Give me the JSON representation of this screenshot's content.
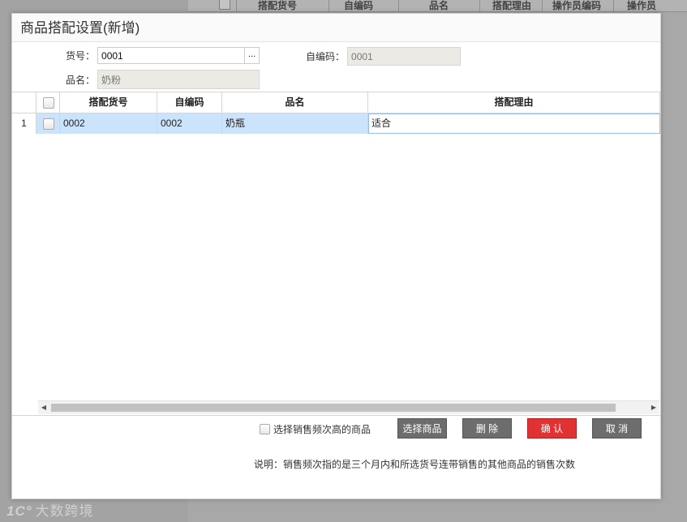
{
  "background": {
    "columns": [
      "搭配货号",
      "自编码",
      "品名",
      "搭配理由",
      "操作员编码",
      "操作员"
    ],
    "watermark": "大数跨境"
  },
  "dialog": {
    "title": "商品搭配设置(新增)",
    "form": {
      "code_label": "货号：",
      "code_value": "0001",
      "picker_label": "...",
      "self_code_label": "自编码：",
      "self_code_value": "0001",
      "name_label": "品名：",
      "name_value": "奶粉"
    },
    "grid": {
      "headers": [
        "搭配货号",
        "自编码",
        "品名",
        "搭配理由"
      ],
      "rows": [
        {
          "num": "1",
          "code": "0002",
          "self_code": "0002",
          "name": "奶瓶",
          "reason": "适合"
        }
      ]
    },
    "footer": {
      "checkbox_label": "选择销售频次高的商品",
      "select_button": "选择商品",
      "delete_button": "删 除",
      "confirm_button": "确 认",
      "cancel_button": "取 消",
      "note": "说明：销售频次指的是三个月内和所选货号连带销售的其他商品的销售次数"
    }
  }
}
